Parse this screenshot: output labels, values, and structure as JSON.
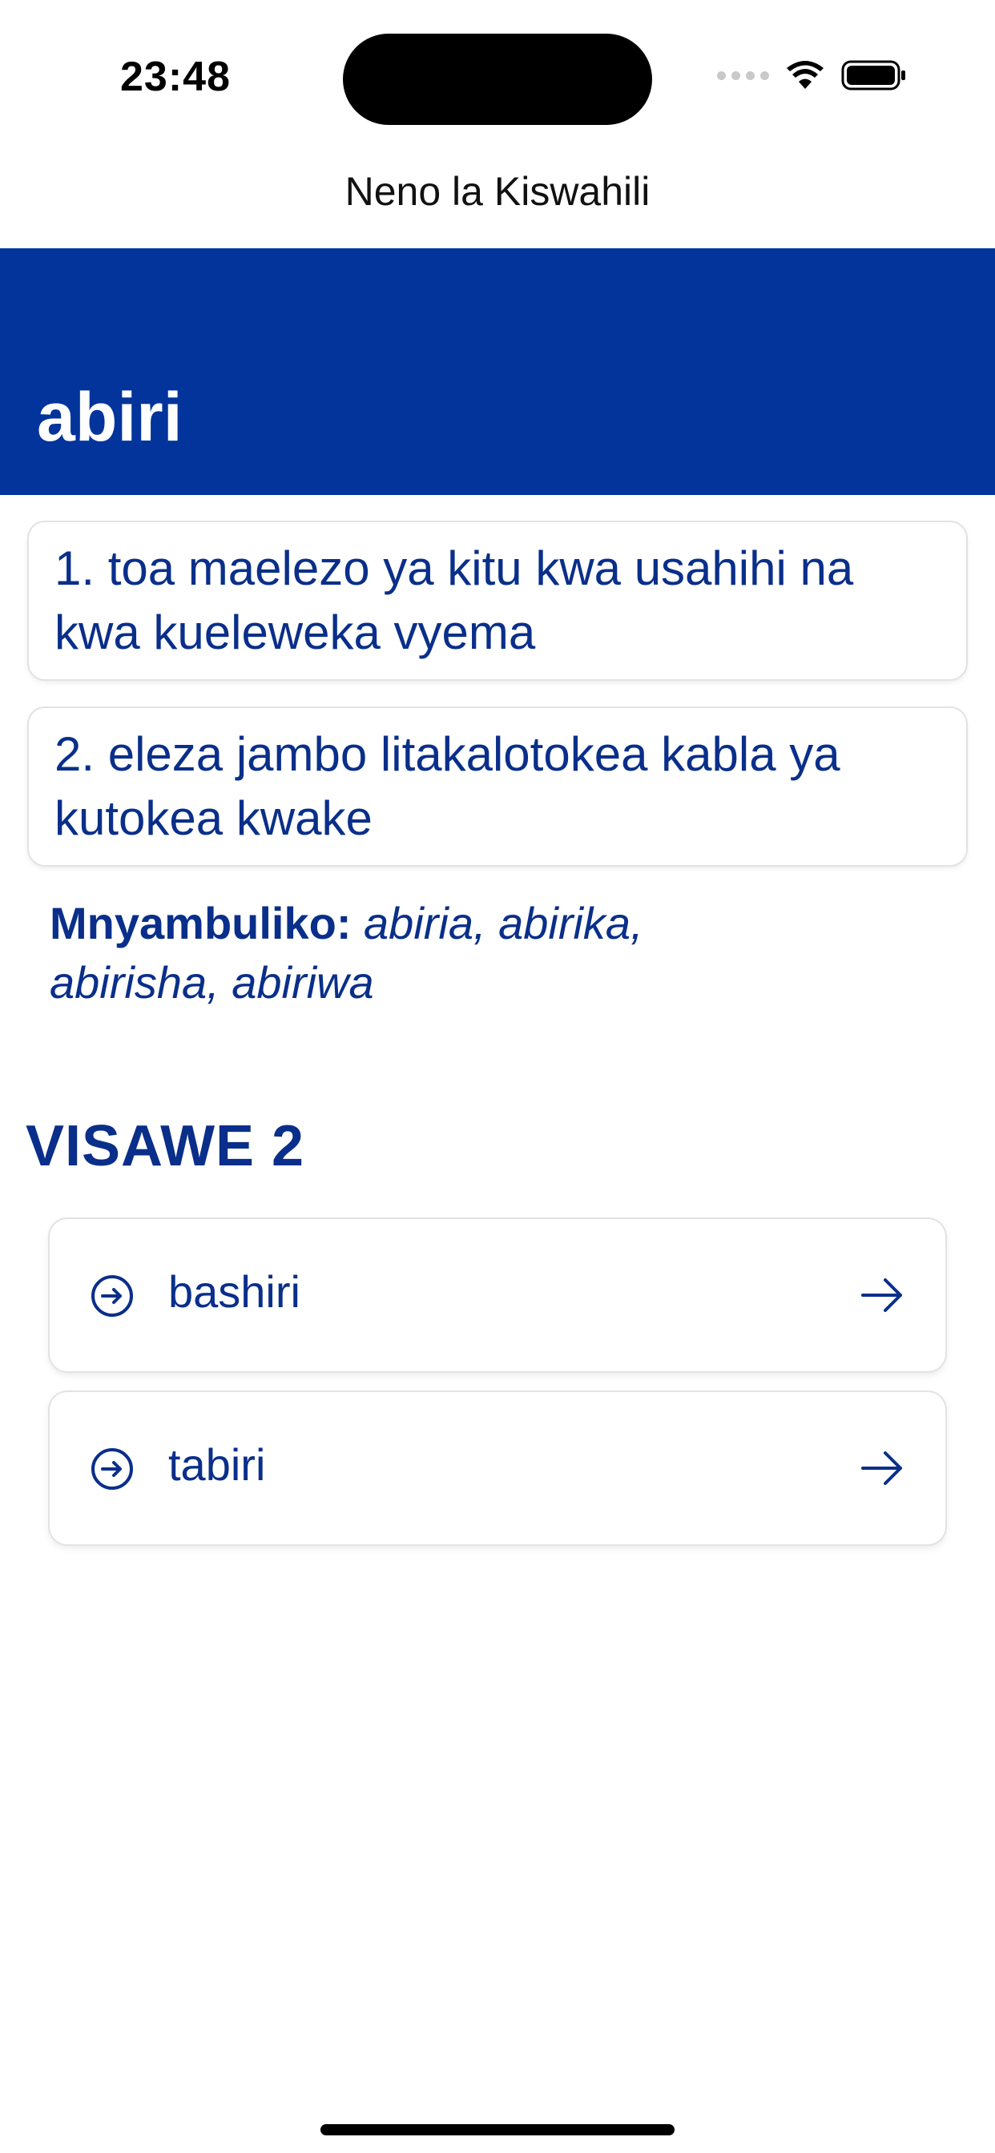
{
  "status_bar": {
    "time": "23:48"
  },
  "nav": {
    "title": "Neno la Kiswahili"
  },
  "word": {
    "headword": "abiri"
  },
  "definitions": [
    {
      "text": "1. toa maelezo ya kitu kwa usahihi na kwa kueleweka vyema"
    },
    {
      "text": "2. eleza jambo litakalotokea kabla ya kutokea kwake"
    }
  ],
  "derivatives": {
    "label": "Mnyambuliko:",
    "values": "abiria, abirika, abirisha, abiriwa"
  },
  "synonyms": {
    "heading": "VISAWE 2",
    "items": [
      {
        "label": "bashiri",
        "lead_icon": "circle-arrow-right-icon",
        "trail_icon": "arrow-right-icon"
      },
      {
        "label": "tabiri",
        "lead_icon": "circle-arrow-right-icon",
        "trail_icon": "arrow-right-icon"
      }
    ]
  },
  "colors": {
    "brand_blue": "#02349c",
    "text_blue": "#0a2f8a",
    "background": "#ffffff"
  }
}
